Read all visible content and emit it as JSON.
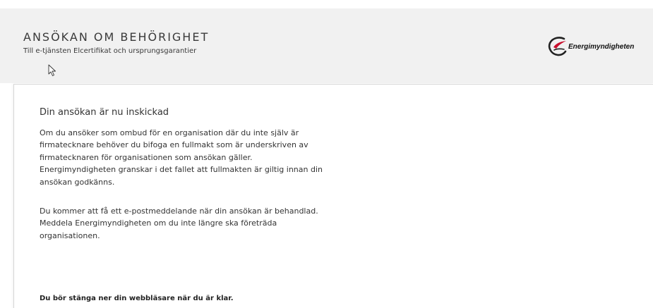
{
  "header": {
    "title": "ANSÖKAN OM BEHÖRIGHET",
    "subtitle": "Till e-tjänsten Elcertifikat och ursprungsgarantier",
    "logo_text": "Energimyndigheten",
    "logo_icon": "energimyndigheten-logo-icon"
  },
  "content": {
    "heading": "Din ansökan är nu inskickad",
    "paragraph1": [
      "Om du ansöker som ombud för en organisation där du inte själv är",
      "firmatecknare behöver du bifoga en fullmakt som är underskriven av",
      "firmatecknaren för organisationen som ansökan gäller.",
      "Energimyndigheten granskar i det fallet att fullmakten är giltig innan din",
      "ansökan godkänns."
    ],
    "paragraph2": [
      "Du kommer att få ett e-postmeddelande när din ansökan är behandlad.",
      "Meddela Energimyndigheten om du inte längre ska företräda",
      "organisationen."
    ],
    "closing_note": "Du bör stänga ner din webbläsare när du är klar."
  },
  "colors": {
    "header_bg": "#f1f1f1",
    "logo_accent": "#c8102e",
    "text": "#333333"
  }
}
